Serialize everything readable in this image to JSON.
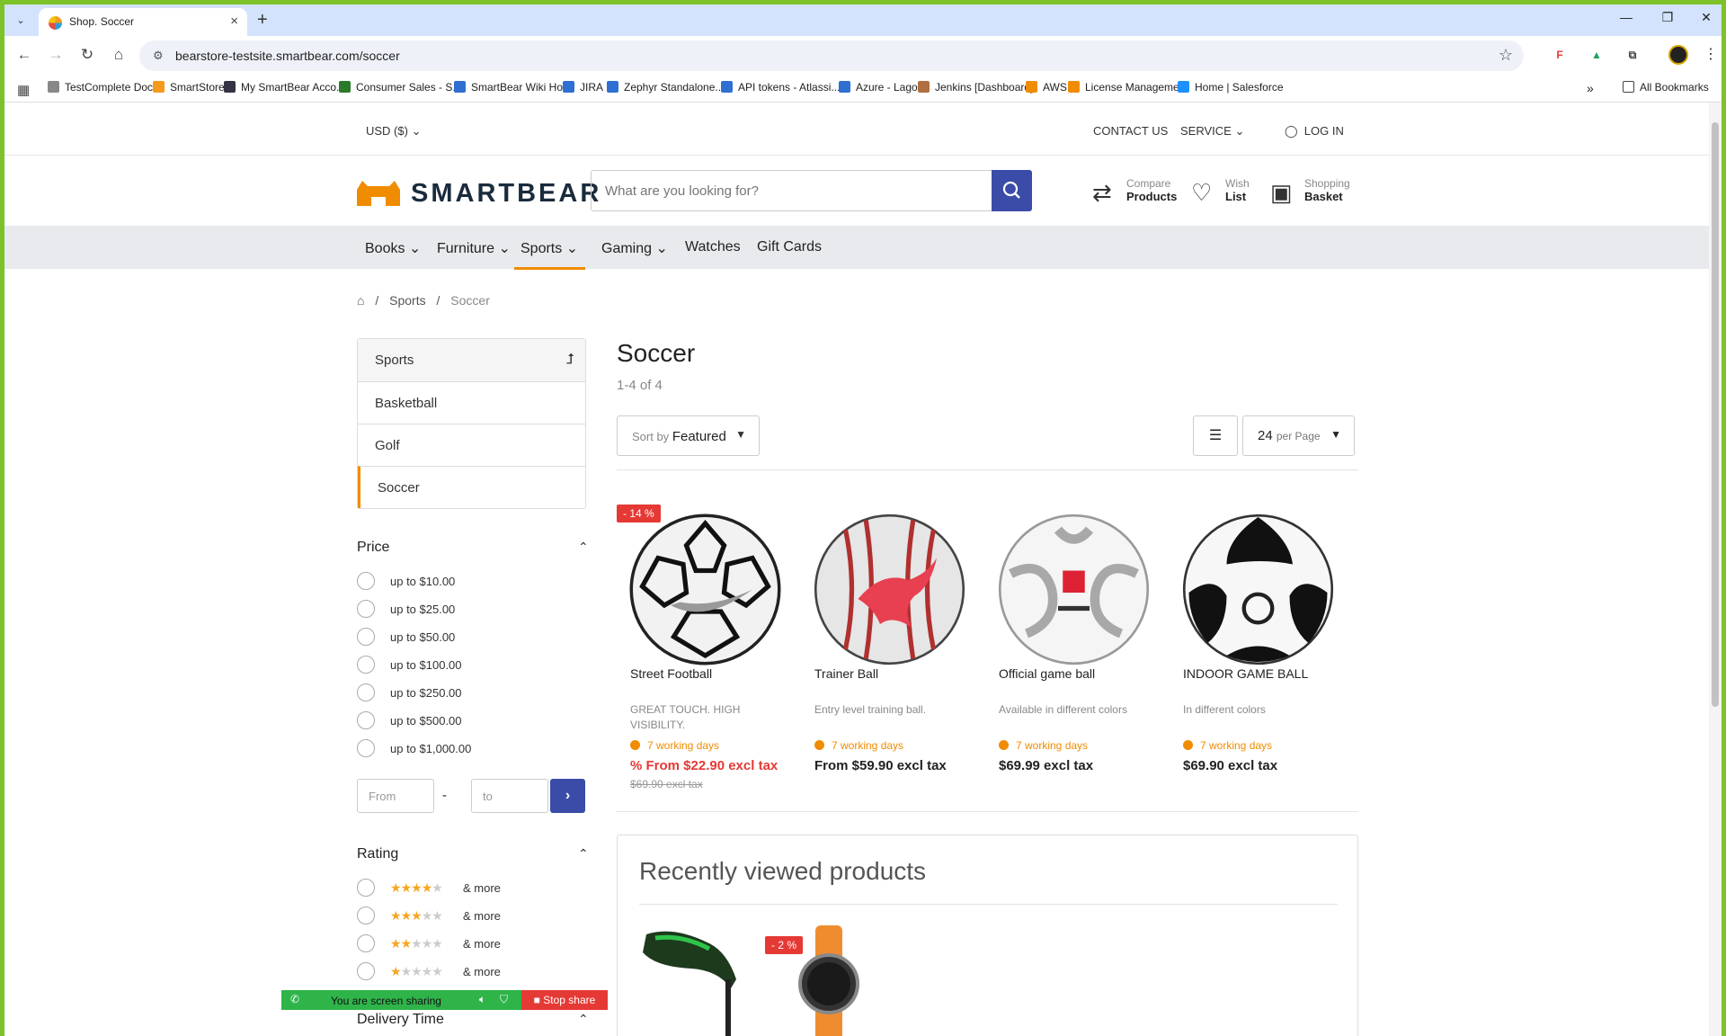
{
  "browser": {
    "tab_title": "Shop. Soccer",
    "url": "bearstore-testsite.smartbear.com/soccer",
    "bookmarks": [
      {
        "label": "TestComplete Docs",
        "color": "#888"
      },
      {
        "label": "SmartStore",
        "color": "#f59a1c"
      },
      {
        "label": "My SmartBear Acco...",
        "color": "#334"
      },
      {
        "label": "Consumer Sales - S...",
        "color": "#2a7a2a"
      },
      {
        "label": "SmartBear Wiki Ho...",
        "color": "#2f6fd1"
      },
      {
        "label": "JIRA",
        "color": "#2f6fd1"
      },
      {
        "label": "Zephyr Standalone...",
        "color": "#2f6fd1"
      },
      {
        "label": "API tokens - Atlassi...",
        "color": "#2f6fd1"
      },
      {
        "label": "Azure - Lago",
        "color": "#2f6fd1"
      },
      {
        "label": "Jenkins [Dashboard]",
        "color": "#b07040"
      },
      {
        "label": "AWS",
        "color": "#f08c00"
      },
      {
        "label": "License Manageme...",
        "color": "#f08c00"
      },
      {
        "label": "Home | Salesforce",
        "color": "#1e90ff"
      }
    ],
    "all_bookmarks": "All Bookmarks"
  },
  "topbar": {
    "currency": "USD  ($)",
    "contact": "CONTACT US",
    "service": "SERVICE",
    "login": "LOG IN"
  },
  "header": {
    "brand": "SMARTBEAR",
    "search_placeholder": "What are you looking for?",
    "compare": {
      "l1": "Compare",
      "l2": "Products"
    },
    "wish": {
      "l1": "Wish",
      "l2": "List"
    },
    "basket": {
      "l1": "Shopping",
      "l2": "Basket"
    }
  },
  "nav": {
    "items": [
      "Books",
      "Furniture",
      "Sports",
      "Gaming",
      "Watches",
      "Gift Cards"
    ],
    "active": "Sports"
  },
  "breadcrumb": {
    "sep": "/",
    "sports": "Sports",
    "current": "Soccer"
  },
  "sidebar": {
    "categories": [
      "Sports",
      "Basketball",
      "Golf",
      "Soccer"
    ],
    "price_title": "Price",
    "price_options": [
      "up to $10.00",
      "up to $25.00",
      "up to $50.00",
      "up to $100.00",
      "up to $250.00",
      "up to $500.00",
      "up to $1,000.00"
    ],
    "from_placeholder": "From",
    "to_placeholder": "to",
    "rating_title": "Rating",
    "rating_options": [
      4,
      3,
      2,
      1
    ],
    "rating_suffix": "& more",
    "delivery_title": "Delivery Time"
  },
  "main": {
    "title": "Soccer",
    "count": "1-4 of 4",
    "sort_prefix": "Sort by",
    "sort_value": "Featured",
    "per_page_value": "24",
    "per_page_suffix": "per Page"
  },
  "products": [
    {
      "name": "Street Football",
      "desc": "GREAT TOUCH. HIGH VISIBILITY.",
      "delivery": "7 working days",
      "price": "% From $22.90 excl tax",
      "old_price": "$69.90 excl tax",
      "badge": "- 14 %"
    },
    {
      "name": "Trainer Ball",
      "desc": "Entry level training ball.",
      "delivery": "7 working days",
      "price": "From $59.90 excl tax"
    },
    {
      "name": "Official game ball",
      "desc": "Available in different colors",
      "delivery": "7 working days",
      "price": "$69.99 excl tax"
    },
    {
      "name": "INDOOR GAME BALL",
      "desc": "In different colors",
      "delivery": "7 working days",
      "price": "$69.90 excl tax"
    }
  ],
  "recent": {
    "title": "Recently viewed products",
    "badge": "- 2 %"
  },
  "share": {
    "text": "You are screen sharing",
    "stop": "Stop share"
  }
}
